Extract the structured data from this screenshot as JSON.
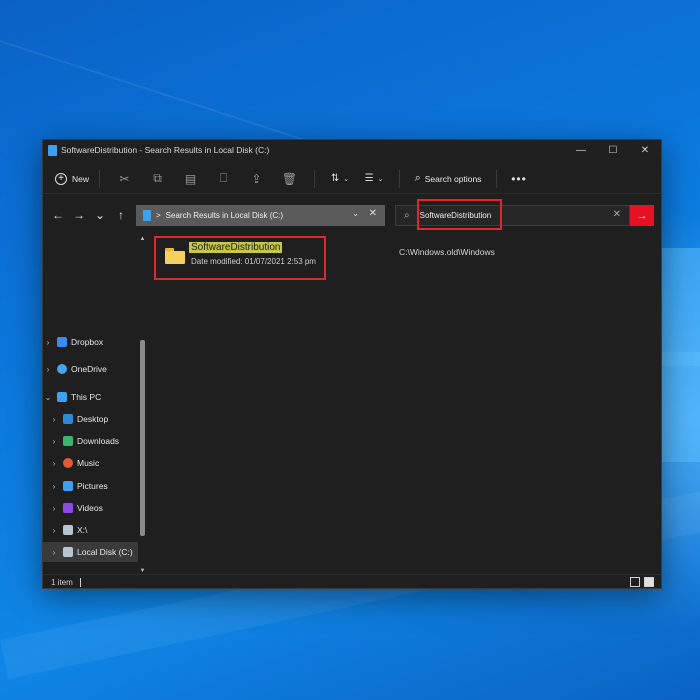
{
  "window": {
    "title": "SoftwareDistribution - Search Results in Local Disk (C:)",
    "controls": {
      "minimize": "—",
      "maximize": "☐",
      "close": "✕"
    }
  },
  "toolbar": {
    "new_label": "New",
    "search_options_label": "Search options",
    "more_label": "•••"
  },
  "navigation": {
    "back": "←",
    "forward": "→",
    "recent": "⌄",
    "up": "↑"
  },
  "address_bar": {
    "separator": ">",
    "text": "Search Results in Local Disk (C:)"
  },
  "search": {
    "value": "SoftwareDistribution",
    "clear": "✕",
    "go": "→"
  },
  "nav_pane": {
    "items": [
      {
        "label": "Dropbox",
        "color": "#3d8af7"
      },
      {
        "label": "OneDrive",
        "color": "#4aa3e8"
      },
      {
        "label": "This PC",
        "color": "#3fa0f0"
      },
      {
        "label": "Desktop",
        "color": "#2c8ad6"
      },
      {
        "label": "Downloads",
        "color": "#3cb371"
      },
      {
        "label": "Music",
        "color": "#e05a3a"
      },
      {
        "label": "Pictures",
        "color": "#3fa0f0"
      },
      {
        "label": "Videos",
        "color": "#8a4be0"
      },
      {
        "label": "X:\\",
        "color": "#b8c4d0"
      },
      {
        "label": "Local Disk (C:)",
        "color": "#b8c4d0"
      }
    ]
  },
  "results": [
    {
      "name": "SoftwareDistribution",
      "meta": "Date modified: 01/07/2021 2:53 pm",
      "path": "C:\\Windows.old\\Windows"
    }
  ],
  "status": {
    "count": "1 item"
  },
  "colors": {
    "accent": "#e81123",
    "highlight_box": "#e0262e",
    "match_highlight": "#c7c94a"
  }
}
